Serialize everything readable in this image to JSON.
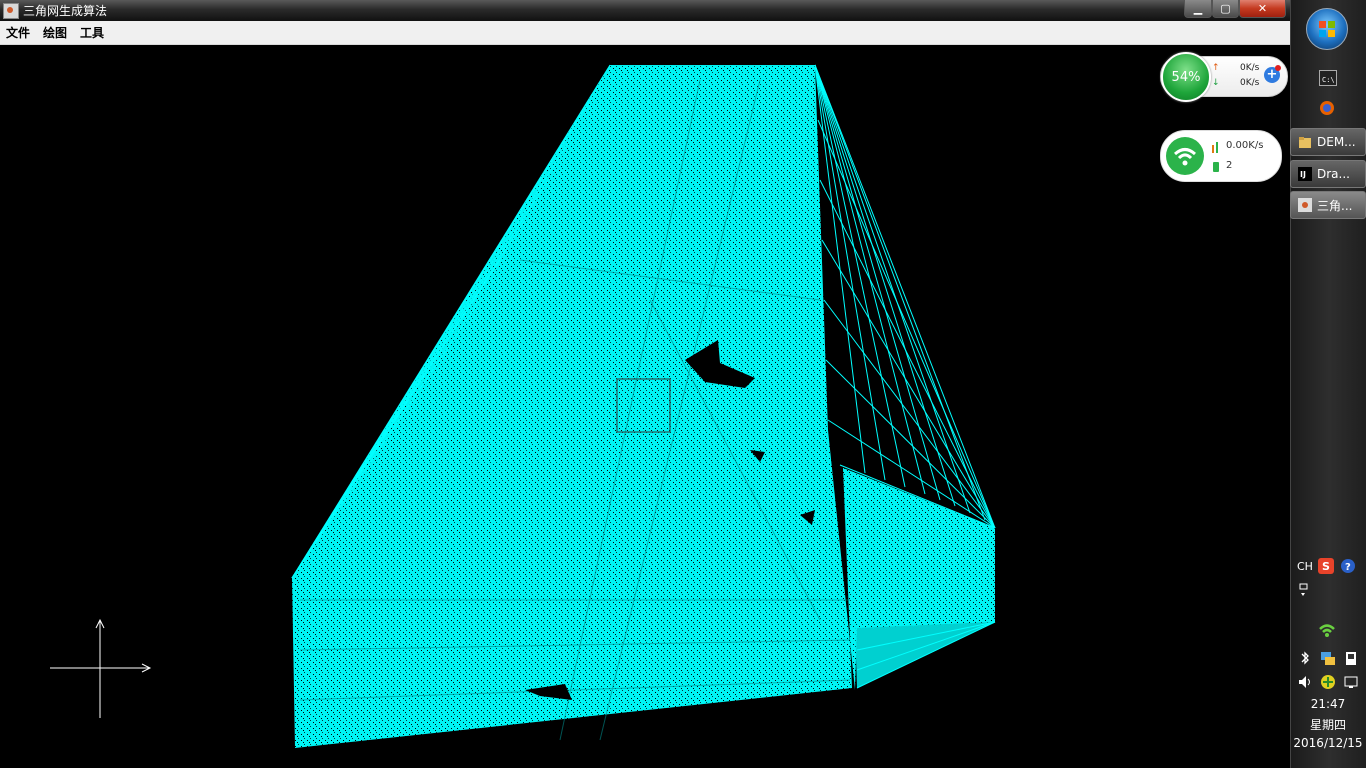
{
  "window": {
    "title": "三角网生成算法",
    "controls": {
      "minimize": "▁",
      "maximize": "▢",
      "close": "✕"
    }
  },
  "menu": {
    "items": [
      {
        "label": "文件"
      },
      {
        "label": "绘图"
      },
      {
        "label": "工具"
      }
    ]
  },
  "canvas": {
    "background": "#000000",
    "mesh_color": "#00ffff"
  },
  "speed_widget": {
    "percent": "54%",
    "upload": "0K/s",
    "download": "0K/s",
    "upload_arrow": "↑",
    "download_arrow": "↓",
    "plus": "+"
  },
  "wifi_widget": {
    "speed": "0.00K/s",
    "devices": "2"
  },
  "taskbar": {
    "buttons": [
      {
        "label": "DEM...",
        "icon": "folder-icon"
      },
      {
        "label": "Dra...",
        "icon": "intellij-icon"
      },
      {
        "label": "三角...",
        "icon": "java-icon",
        "active": true
      }
    ],
    "tray": {
      "lang": "CH",
      "time": "21:47",
      "weekday": "星期四",
      "date": "2016/12/15"
    }
  }
}
